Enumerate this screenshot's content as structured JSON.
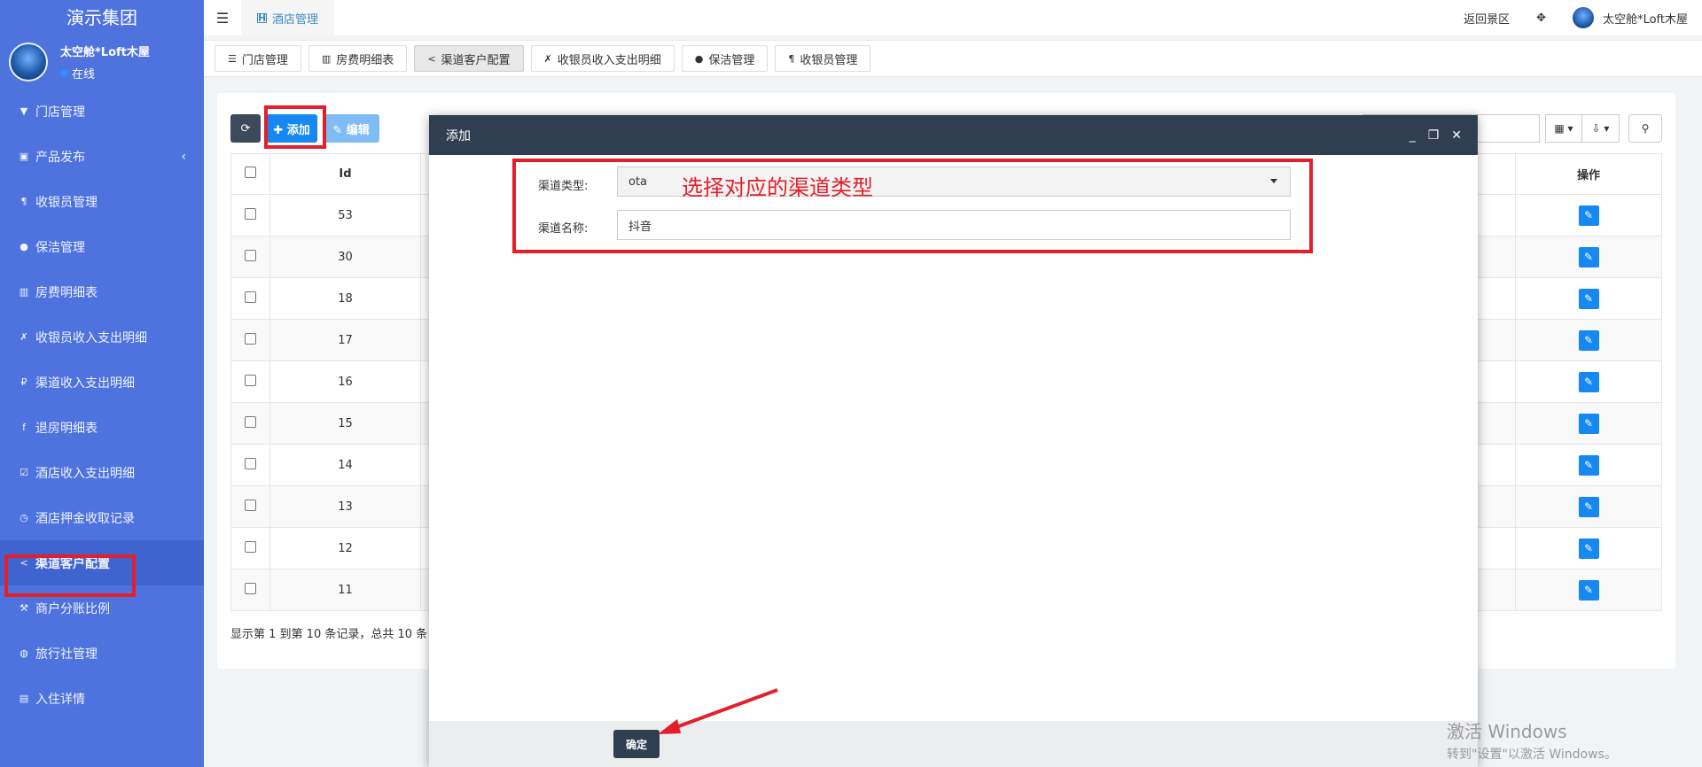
{
  "brand": "演示集团",
  "user": {
    "name": "太空舱*Loft木屋",
    "status": "在线",
    "avatar_text": ""
  },
  "sidebar": {
    "items": [
      {
        "icon": "filter-icon",
        "glyph": "▼",
        "label": "门店管理"
      },
      {
        "icon": "product-icon",
        "glyph": "▣",
        "label": "产品发布",
        "chevron": "‹"
      },
      {
        "icon": "paragraph-icon",
        "glyph": "¶",
        "label": "收银员管理"
      },
      {
        "icon": "user-icon",
        "glyph": "●",
        "label": "保洁管理"
      },
      {
        "icon": "bar-chart-icon",
        "glyph": "▥",
        "label": "房费明细表"
      },
      {
        "icon": "feather-icon",
        "glyph": "✗",
        "label": "收银员收入支出明细"
      },
      {
        "icon": "ruble-icon",
        "glyph": "₽",
        "label": "渠道收入支出明细"
      },
      {
        "icon": "facebook-icon",
        "glyph": "f",
        "label": "退房明细表"
      },
      {
        "icon": "check-square-icon",
        "glyph": "☑",
        "label": "酒店收入支出明细"
      },
      {
        "icon": "clock-icon",
        "glyph": "◷",
        "label": "酒店押金收取记录"
      },
      {
        "icon": "share-icon",
        "glyph": "<",
        "label": "渠道客户配置",
        "active": true
      },
      {
        "icon": "gavel-icon",
        "glyph": "⚒",
        "label": "商户分账比例"
      },
      {
        "icon": "globe-icon",
        "glyph": "◍",
        "label": "旅行社管理"
      },
      {
        "icon": "book-icon",
        "glyph": "▤",
        "label": "入住详情"
      }
    ]
  },
  "header": {
    "tab_label": "酒店管理",
    "tab_glyph": "H",
    "back_label": "返回景区",
    "fullscreen_glyph": "✥",
    "user_name": "太空舱*Loft木屋"
  },
  "subtabs": [
    {
      "glyph": "☰",
      "label": "门店管理"
    },
    {
      "glyph": "▥",
      "label": "房费明细表"
    },
    {
      "glyph": "<",
      "label": "渠道客户配置",
      "active": true
    },
    {
      "glyph": "✗",
      "label": "收银员收入支出明细"
    },
    {
      "glyph": "●",
      "label": "保洁管理"
    },
    {
      "glyph": "¶",
      "label": "收银员管理"
    }
  ],
  "toolbar": {
    "refresh_glyph": "⟳",
    "add_label": "✚ 添加",
    "edit_label": "✎ 编辑"
  },
  "table": {
    "headers": {
      "id": "Id",
      "ops": "操作"
    },
    "rows": [
      "53",
      "30",
      "18",
      "17",
      "16",
      "15",
      "14",
      "13",
      "12",
      "11"
    ]
  },
  "pagination_info": "显示第 1 到第 10 条记录，总共 10 条",
  "modal": {
    "title": "添加",
    "min_glyph": "_",
    "max_glyph": "❐",
    "close_glyph": "✕",
    "type_label": "渠道类型:",
    "type_value": "ota",
    "name_label": "渠道名称:",
    "name_value": "抖音",
    "annotation": "选择对应的渠道类型",
    "confirm_label": "确定"
  },
  "watermark": {
    "line1": "激活 Windows",
    "line2": "转到\"设置\"以激活 Windows。"
  },
  "colors": {
    "sidebar": "#4e73df",
    "primary": "#1688f2",
    "modal_header": "#2f3e50",
    "highlight": "#e3202a"
  }
}
